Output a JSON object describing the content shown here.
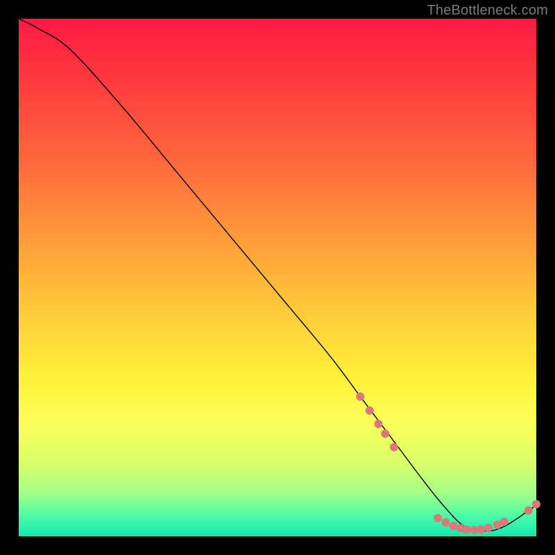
{
  "watermark": "TheBottleneck.com",
  "chart_data": {
    "type": "line",
    "title": "",
    "xlabel": "",
    "ylabel": "",
    "xlim": [
      0,
      100
    ],
    "ylim": [
      0,
      100
    ],
    "series": [
      {
        "name": "curve",
        "x": [
          0,
          4,
          10,
          20,
          30,
          40,
          50,
          60,
          66,
          72,
          78,
          82,
          86,
          90,
          94,
          100
        ],
        "y": [
          100,
          98,
          94,
          83,
          71,
          59,
          47,
          35,
          27,
          19,
          11,
          6,
          2,
          1,
          2,
          6
        ]
      }
    ],
    "markers": [
      {
        "x": 66.0,
        "y": 27.0
      },
      {
        "x": 67.8,
        "y": 24.3
      },
      {
        "x": 69.5,
        "y": 21.7
      },
      {
        "x": 70.8,
        "y": 19.8
      },
      {
        "x": 72.5,
        "y": 17.2
      },
      {
        "x": 81.0,
        "y": 3.5
      },
      {
        "x": 82.5,
        "y": 2.7
      },
      {
        "x": 84.0,
        "y": 2.0
      },
      {
        "x": 85.3,
        "y": 1.6
      },
      {
        "x": 86.5,
        "y": 1.3
      },
      {
        "x": 88.0,
        "y": 1.2
      },
      {
        "x": 89.3,
        "y": 1.3
      },
      {
        "x": 90.7,
        "y": 1.6
      },
      {
        "x": 92.5,
        "y": 2.2
      },
      {
        "x": 93.8,
        "y": 2.8
      },
      {
        "x": 98.5,
        "y": 5.0
      },
      {
        "x": 100.0,
        "y": 6.2
      }
    ],
    "gradient_stops": [
      {
        "offset": 0.0,
        "color": "#ff1a44"
      },
      {
        "offset": 0.7,
        "color": "#fff23a"
      },
      {
        "offset": 0.96,
        "color": "#4dfba8"
      },
      {
        "offset": 1.0,
        "color": "#16e9b0"
      }
    ],
    "curve_color": "#000000",
    "marker_color": "#d97a78",
    "marker_radius": 6
  }
}
